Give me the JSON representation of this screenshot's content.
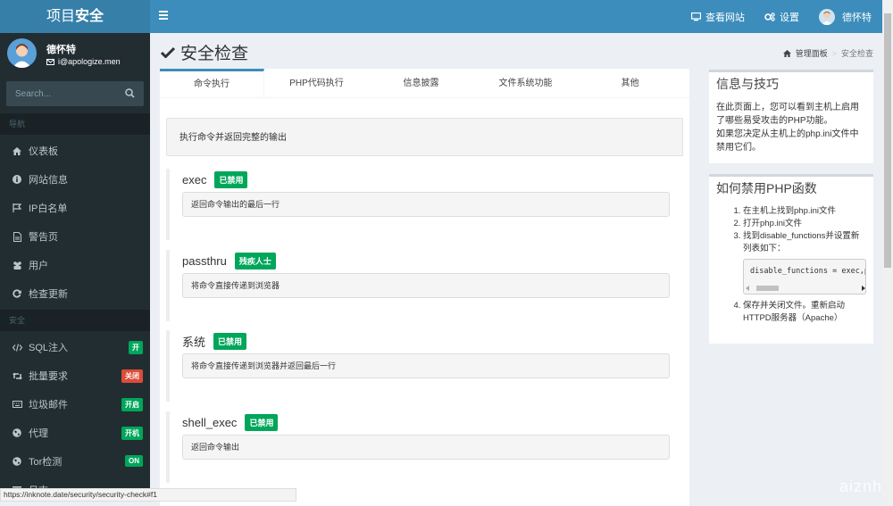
{
  "app": {
    "logo_part1": "项目",
    "logo_part2": "安全"
  },
  "topnav": {
    "view_site": "查看网站",
    "settings": "设置",
    "user": "德怀特"
  },
  "sidebar": {
    "user_name": "德怀特",
    "user_email": "i@apologize.men",
    "search_placeholder": "Search...",
    "nav_header": "导航",
    "nav_items": [
      {
        "label": "仪表板",
        "icon": "home-icon"
      },
      {
        "label": "网站信息",
        "icon": "info-icon"
      },
      {
        "label": "IP白名单",
        "icon": "flag-icon"
      },
      {
        "label": "警告页",
        "icon": "file-icon"
      },
      {
        "label": "用户",
        "icon": "users-icon"
      },
      {
        "label": "检查更新",
        "icon": "refresh-icon"
      }
    ],
    "security_header": "安全",
    "security_items": [
      {
        "label": "SQL注入",
        "icon": "code-icon",
        "badge": "开",
        "badge_color": "#00a65a"
      },
      {
        "label": "批量要求",
        "icon": "retweet-icon",
        "badge": "关闭",
        "badge_color": "#dd4b39"
      },
      {
        "label": "垃圾邮件",
        "icon": "keyboard-icon",
        "badge": "开启",
        "badge_color": "#00a65a"
      },
      {
        "label": "代理",
        "icon": "globe-icon",
        "badge": "开机",
        "badge_color": "#00a65a"
      },
      {
        "label": "Tor检测",
        "icon": "globe-icon",
        "badge": "ON",
        "badge_color": "#00a65a"
      },
      {
        "label": "日志",
        "icon": "list-icon"
      }
    ]
  },
  "page": {
    "title": "安全检查",
    "breadcrumb_home": "管理面板",
    "breadcrumb_current": "安全检查"
  },
  "tabs": [
    {
      "label": "命令执行",
      "active": true
    },
    {
      "label": "PHP代码执行",
      "active": false
    },
    {
      "label": "信息披露",
      "active": false
    },
    {
      "label": "文件系统功能",
      "active": false
    },
    {
      "label": "其他",
      "active": false
    }
  ],
  "tab_description": "执行命令并返回完整的输出",
  "functions": [
    {
      "name": "exec",
      "status": "已禁用",
      "description": "返回命令输出的最后一行"
    },
    {
      "name": "passthru",
      "status": "残疾人士",
      "description": "将命令直接传递到浏览器"
    },
    {
      "name": "系统",
      "status": "已禁用",
      "description": "将命令直接传递到浏览器并返回最后一行"
    },
    {
      "name": "shell_exec",
      "status": "已禁用",
      "description": "返回命令输出"
    }
  ],
  "tips": {
    "title": "信息与技巧",
    "text1": "在此页面上，您可以看到主机上启用了哪些易受攻击的PHP功能。",
    "text2": "如果您决定从主机上的php.ini文件中禁用它们。"
  },
  "howto": {
    "title": "如何禁用PHP函数",
    "steps": [
      "在主机上找到php.ini文件",
      "打开php.ini文件",
      "找到disable_functions并设置新列表如下：",
      "保存并关闭文件。重新启动HTTPD服务器（Apache）"
    ],
    "code": "disable_functions = exec,passthru,shell_exec,system"
  },
  "status_bar_url": "https://inknote.date/security/security-check#f1",
  "watermark": "aiznh"
}
